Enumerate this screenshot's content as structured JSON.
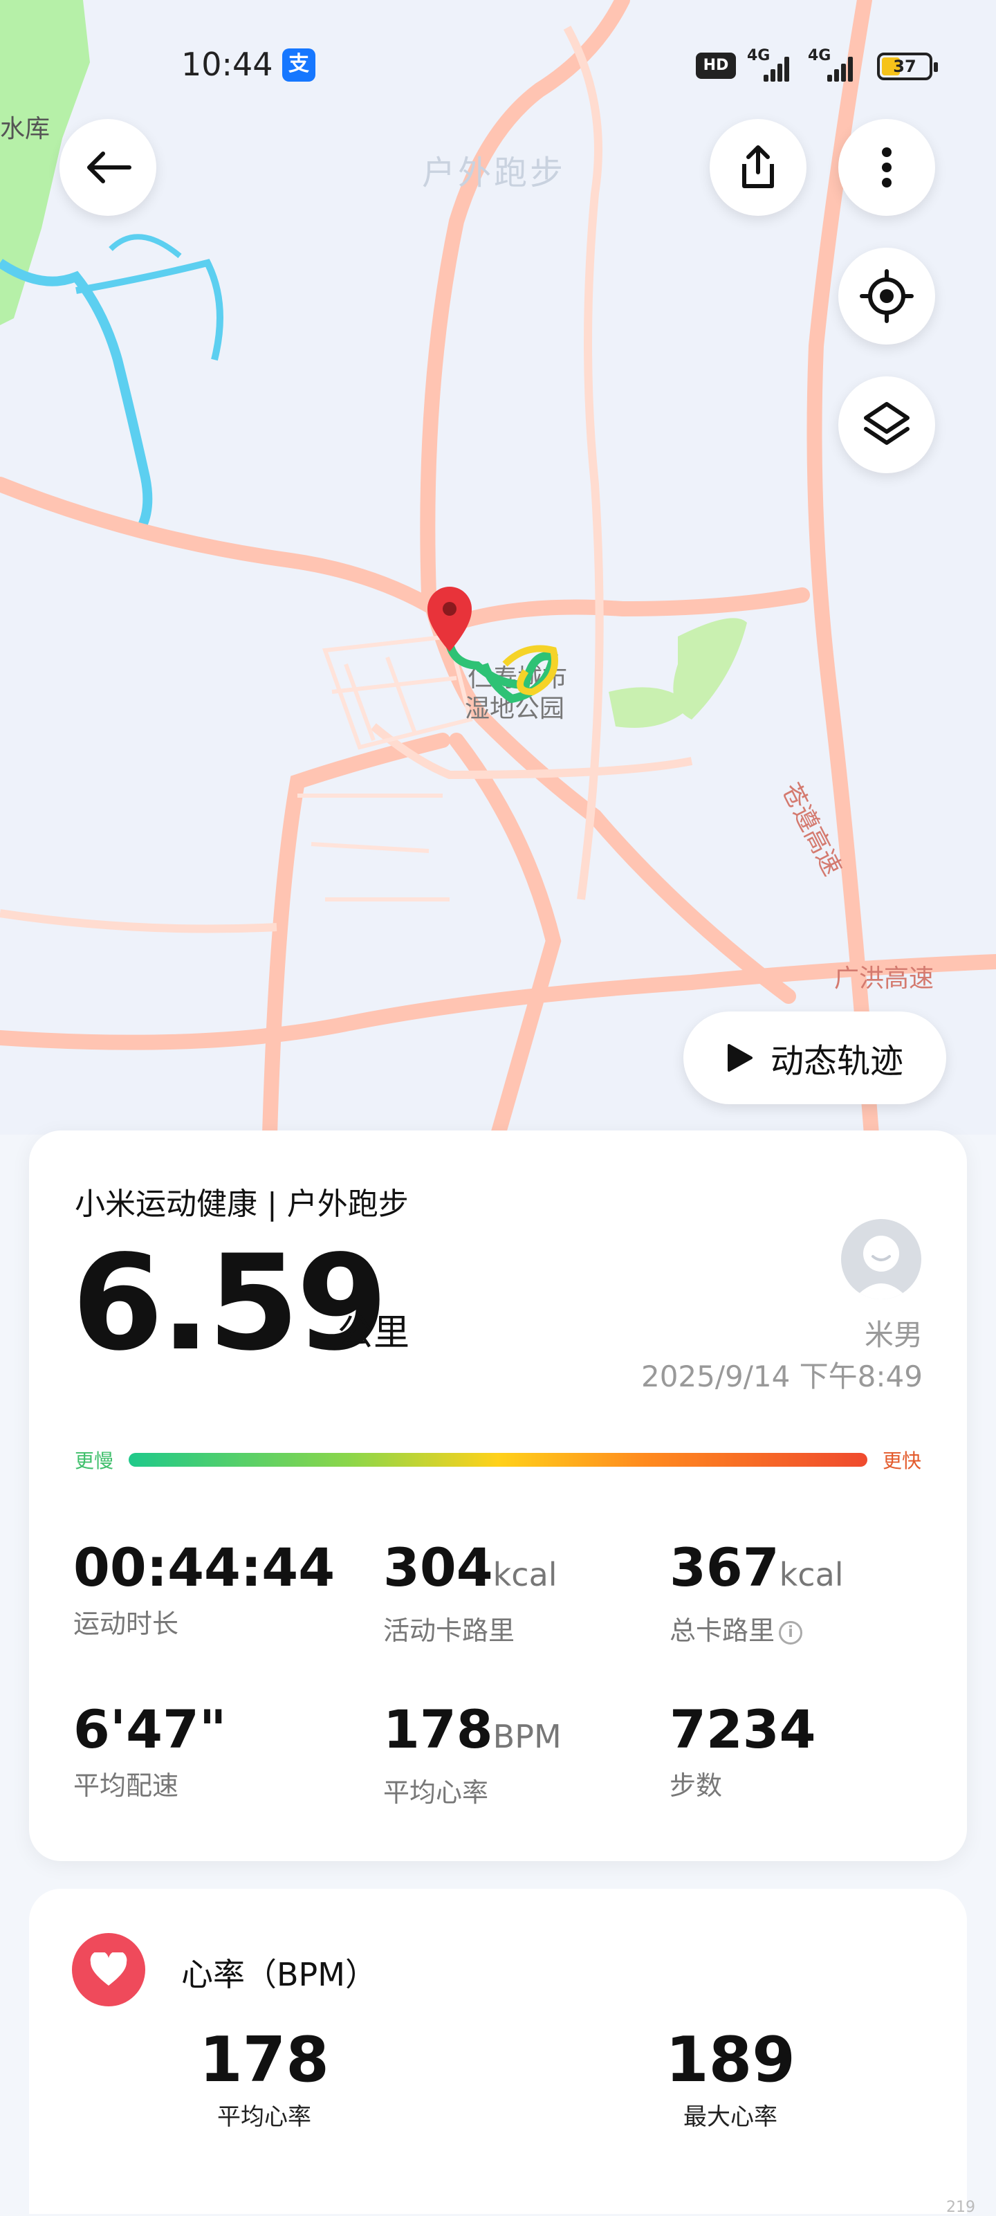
{
  "status_bar": {
    "time": "10:44",
    "alipay_glyph": "支",
    "hd_label": "HD",
    "net1": "4G",
    "net2": "4G",
    "battery": "37"
  },
  "map": {
    "watermark": "户外跑步",
    "labels": {
      "reservoir": "水库",
      "park_line1": "仁寿城市",
      "park_line2": "湿地公园",
      "highway_vertical": "苍遵高速",
      "highway_horizontal": "广洪高速"
    },
    "colors": {
      "water": "#5ccff0",
      "green": "#b6f0a8",
      "road": "#ffcfc1",
      "route_green": "#2ec275",
      "route_yellow": "#f5d328"
    },
    "dynamic_track_label": "动态轨迹"
  },
  "summary": {
    "app_title": "小米运动健康 | 户外跑步",
    "distance": "6.59",
    "distance_unit": "公里",
    "user_name": "米男",
    "datetime": "2025/9/14 下午8:49",
    "slower_label": "更慢",
    "faster_label": "更快",
    "stats": [
      {
        "value": "00:44:44",
        "unit": "",
        "label": "运动时长"
      },
      {
        "value": "304",
        "unit": "kcal",
        "label": "活动卡路里"
      },
      {
        "value": "367",
        "unit": "kcal",
        "label": "总卡路里"
      },
      {
        "value": "6'47\"",
        "unit": "",
        "label": "平均配速"
      },
      {
        "value": "178",
        "unit": "BPM",
        "label": "平均心率"
      },
      {
        "value": "7234",
        "unit": "",
        "label": "步数"
      }
    ]
  },
  "heart_rate": {
    "title": "心率（BPM）",
    "avg_value": "178",
    "avg_label": "平均心率",
    "max_value": "189",
    "max_label": "最大心率"
  },
  "corner_number": "219"
}
